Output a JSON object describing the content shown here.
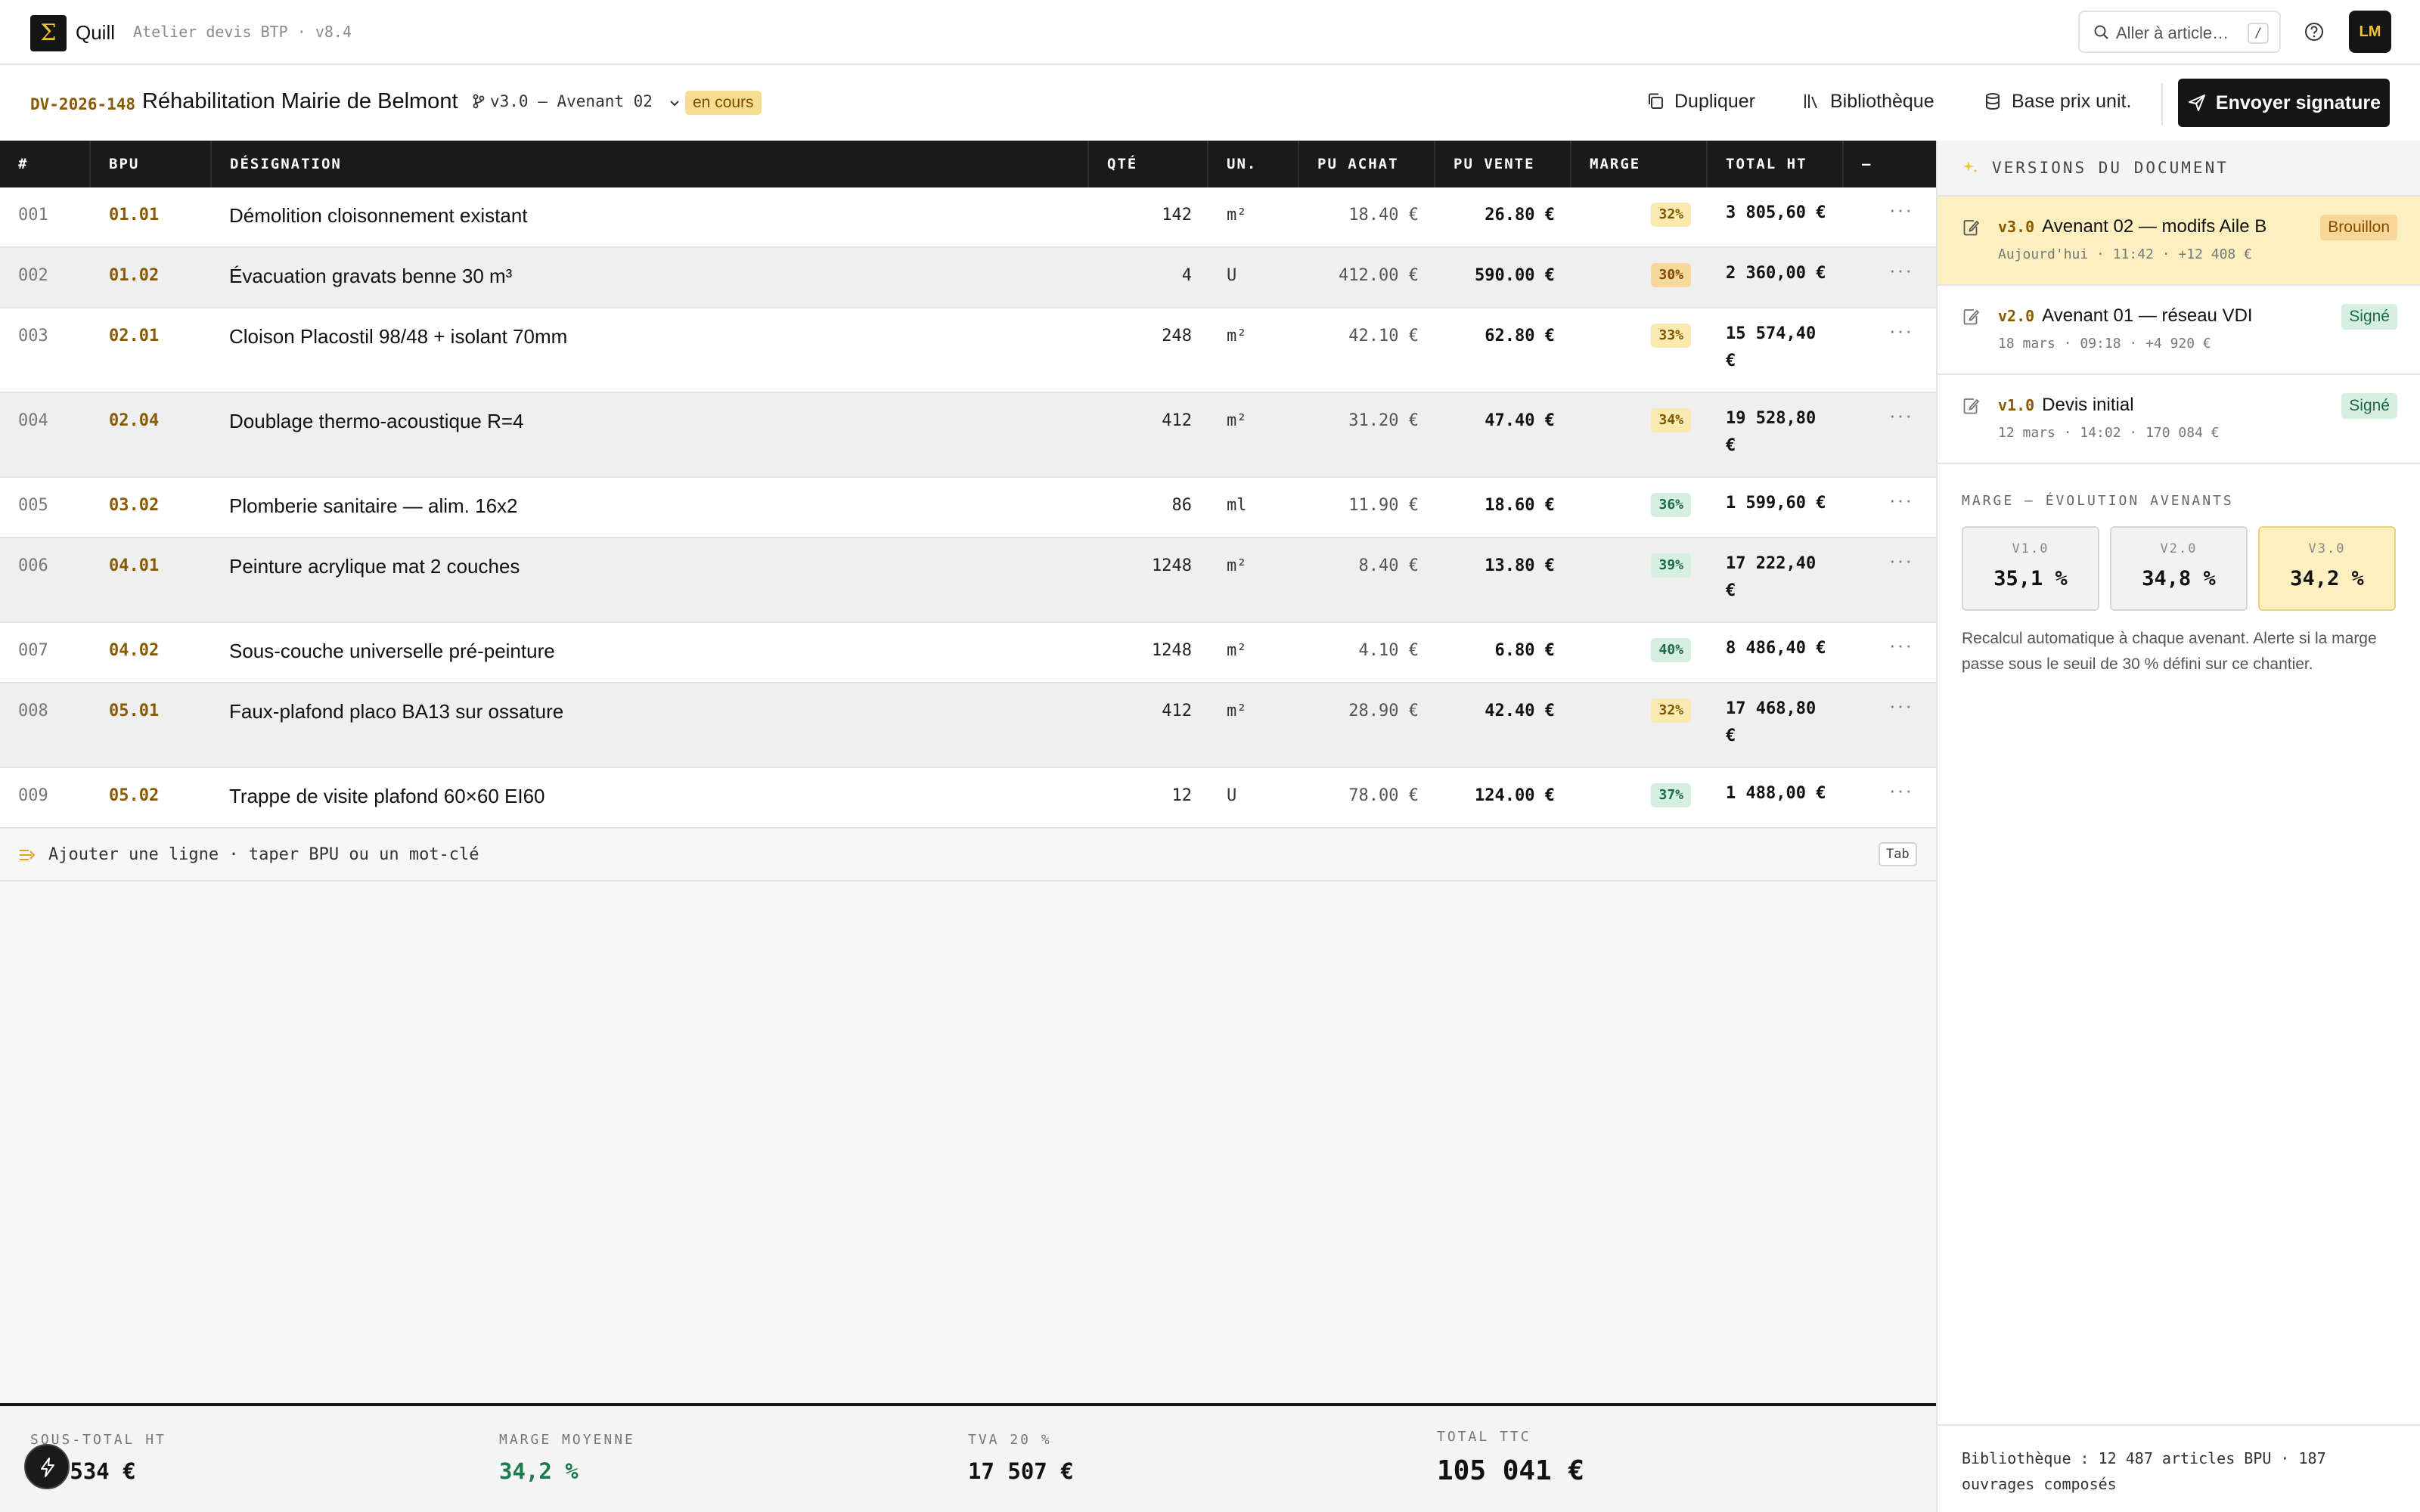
{
  "app": {
    "logo_glyph": "Σ",
    "name": "Quill",
    "subtitle": "Atelier devis BTP · v8.4",
    "search_placeholder": "Aller à article…",
    "search_shortcut": "/",
    "avatar_initials": "LM",
    "accent_color": "#f2c230"
  },
  "document": {
    "id": "DV-2026-148",
    "title": "Réhabilitation Mairie de Belmont",
    "branch": "v3.0 — Avenant 02",
    "status": "en cours",
    "actions": {
      "duplicate": "Dupliquer",
      "library": "Bibliothèque",
      "price_base": "Base prix unit.",
      "send": "Envoyer signature"
    }
  },
  "table": {
    "headers": [
      "#",
      "BPU",
      "DÉSIGNATION",
      "QTÉ",
      "UN.",
      "PU ACHAT",
      "PU VENTE",
      "MARGE",
      "TOTAL HT",
      "—"
    ],
    "rows": [
      {
        "num": "001",
        "bpu": "01.01",
        "designation": "Démolition cloisonnement existant",
        "qte": "142",
        "unit": "m²",
        "pu_achat": "18.40 €",
        "pu_vente": "26.80 €",
        "marge": "32%",
        "marge_level": "yellow",
        "total_l1": "3 805,60 €",
        "total_l2": "",
        "more": "···"
      },
      {
        "num": "002",
        "bpu": "01.02",
        "designation": "Évacuation gravats benne 30 m³",
        "qte": "4",
        "unit": "U",
        "pu_achat": "412.00 €",
        "pu_vente": "590.00 €",
        "marge": "30%",
        "marge_level": "orange",
        "total_l1": "2 360,00 €",
        "total_l2": "",
        "more": "···"
      },
      {
        "num": "003",
        "bpu": "02.01",
        "designation": "Cloison Placostil 98/48 + isolant 70mm",
        "qte": "248",
        "unit": "m²",
        "pu_achat": "42.10 €",
        "pu_vente": "62.80 €",
        "marge": "33%",
        "marge_level": "yellow",
        "total_l1": "15 574,40",
        "total_l2": "€",
        "more": "···"
      },
      {
        "num": "004",
        "bpu": "02.04",
        "designation": "Doublage thermo-acoustique R=4",
        "qte": "412",
        "unit": "m²",
        "pu_achat": "31.20 €",
        "pu_vente": "47.40 €",
        "marge": "34%",
        "marge_level": "yellow",
        "total_l1": "19 528,80",
        "total_l2": "€",
        "more": "···"
      },
      {
        "num": "005",
        "bpu": "03.02",
        "designation": "Plomberie sanitaire — alim. 16x2",
        "qte": "86",
        "unit": "ml",
        "pu_achat": "11.90 €",
        "pu_vente": "18.60 €",
        "marge": "36%",
        "marge_level": "green",
        "total_l1": "1 599,60 €",
        "total_l2": "",
        "more": "···"
      },
      {
        "num": "006",
        "bpu": "04.01",
        "designation": "Peinture acrylique mat 2 couches",
        "qte": "1248",
        "unit": "m²",
        "pu_achat": "8.40 €",
        "pu_vente": "13.80 €",
        "marge": "39%",
        "marge_level": "green",
        "total_l1": "17 222,40",
        "total_l2": "€",
        "more": "···"
      },
      {
        "num": "007",
        "bpu": "04.02",
        "designation": "Sous-couche universelle pré-peinture",
        "qte": "1248",
        "unit": "m²",
        "pu_achat": "4.10 €",
        "pu_vente": "6.80 €",
        "marge": "40%",
        "marge_level": "green",
        "total_l1": "8 486,40 €",
        "total_l2": "",
        "more": "···"
      },
      {
        "num": "008",
        "bpu": "05.01",
        "designation": "Faux-plafond placo BA13 sur ossature",
        "qte": "412",
        "unit": "m²",
        "pu_achat": "28.90 €",
        "pu_vente": "42.40 €",
        "marge": "32%",
        "marge_level": "yellow",
        "total_l1": "17 468,80",
        "total_l2": "€",
        "more": "···"
      },
      {
        "num": "009",
        "bpu": "05.02",
        "designation": "Trappe de visite plafond 60×60 EI60",
        "qte": "12",
        "unit": "U",
        "pu_achat": "78.00 €",
        "pu_vente": "124.00 €",
        "marge": "37%",
        "marge_level": "green",
        "total_l1": "1 488,00 €",
        "total_l2": "",
        "more": "···"
      }
    ],
    "add_row_label": "Ajouter une ligne · taper BPU ou un mot-clé",
    "add_row_shortcut": "Tab"
  },
  "totals": {
    "subtotal_label": "SOUS-TOTAL HT",
    "subtotal_value": "87 534 €",
    "margin_label": "MARGE MOYENNE",
    "margin_value": "34,2 %",
    "vat_label": "TVA 20 %",
    "vat_value": "17 507 €",
    "ttc_label": "TOTAL TTC",
    "ttc_value": "105 041 €"
  },
  "versions_panel": {
    "title": "VERSIONS DU DOCUMENT",
    "versions": [
      {
        "tag": "v3.0",
        "name": "Avenant 02 — modifs Aile B",
        "meta": "Aujourd'hui · 11:42 · +12 408 €",
        "badge": "Brouillon"
      },
      {
        "tag": "v2.0",
        "name": "Avenant 01 — réseau VDI",
        "meta": "18 mars · 09:18 · +4 920 €",
        "badge": "Signé"
      },
      {
        "tag": "v1.0",
        "name": "Devis initial",
        "meta": "12 mars · 14:02 · 170 084 €",
        "badge": "Signé"
      }
    ],
    "margin_title": "MARGE — ÉVOLUTION AVENANTS",
    "margin_cards": [
      {
        "label": "V1.0",
        "value": "35,1 %"
      },
      {
        "label": "V2.0",
        "value": "34,8 %"
      },
      {
        "label": "V3.0",
        "value": "34,2 %"
      }
    ],
    "note": "Recalcul automatique à chaque avenant. Alerte si la marge passe sous le seuil de 30 % défini sur ce chantier.",
    "footer": "Bibliothèque : 12 487 articles BPU · 187 ouvrages composés"
  }
}
